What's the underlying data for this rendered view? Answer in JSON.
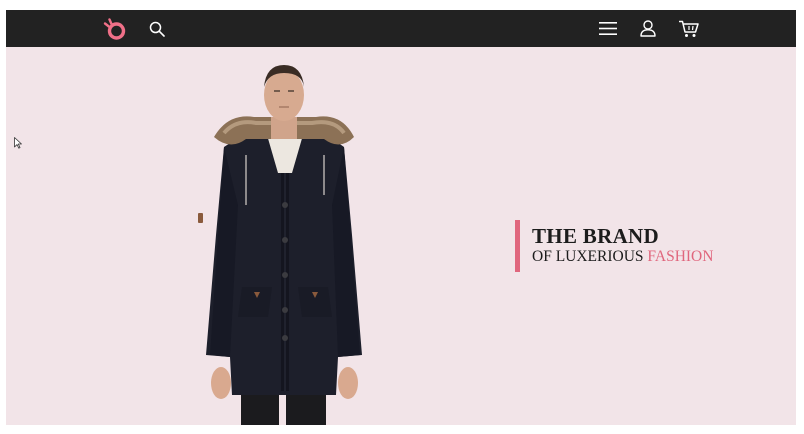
{
  "header": {
    "icons": [
      "logo-icon",
      "search-icon",
      "menu-icon",
      "user-icon",
      "cart-icon"
    ]
  },
  "hero": {
    "headline": "THE BRAND",
    "subline_prefix": "OF LUXERIOUS",
    "subline_highlight": "FASHION",
    "image": "model-in-navy-parka-with-fur-hood"
  },
  "colors": {
    "topbar": "#222222",
    "background": "#f2e4e8",
    "accent": "#e0667d",
    "text": "#1c1c1c"
  }
}
